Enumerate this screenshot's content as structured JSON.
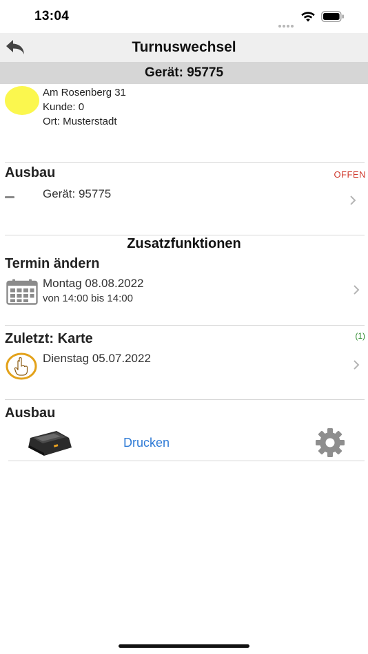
{
  "status_bar": {
    "time": "13:04"
  },
  "nav": {
    "title": "Turnuswechsel"
  },
  "device": {
    "header": "Gerät: 95775"
  },
  "address": {
    "street": "Am Rosenberg 31",
    "customer": "Kunde: 0",
    "city": "Ort: Musterstadt",
    "status_color": "#fbf74e"
  },
  "ausbau": {
    "heading": "Ausbau",
    "status": "OFFEN",
    "status_color": "#d03a2e",
    "item": "Gerät: 95775"
  },
  "extras": {
    "heading": "Zusatzfunktionen"
  },
  "termin": {
    "heading": "Termin ändern",
    "date": "Montag 08.08.2022",
    "time": "von 14:00 bis 14:00",
    "icon": "calendar-icon"
  },
  "zuletzt": {
    "heading": "Zuletzt: Karte",
    "count": "(1)",
    "date": "Dienstag 05.07.2022",
    "icon": "finger-icon"
  },
  "print_section": {
    "heading": "Ausbau",
    "print_label": "Drucken",
    "link_color": "#2f7bd6"
  }
}
